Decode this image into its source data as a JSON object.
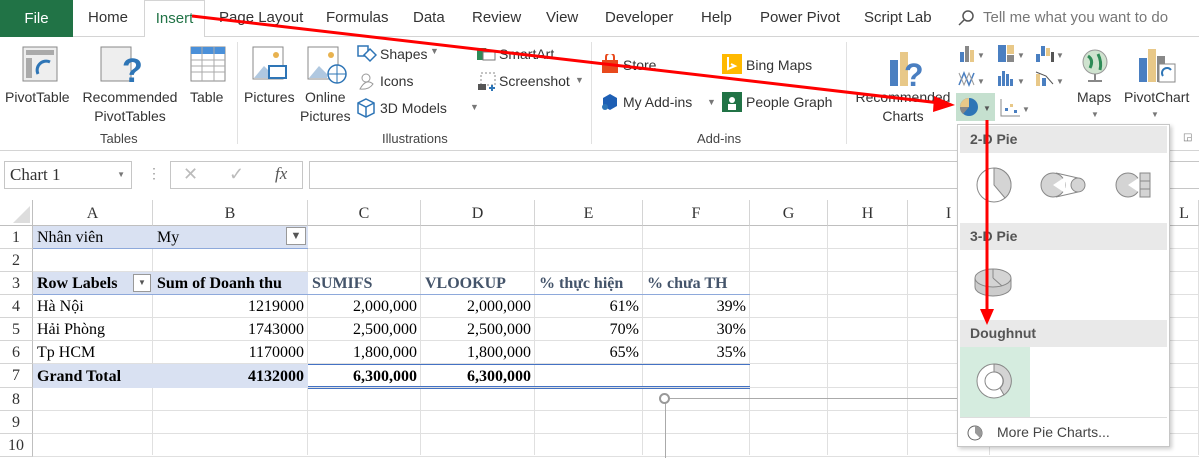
{
  "tabs": {
    "file": "File",
    "items": [
      "Home",
      "Insert",
      "Page Layout",
      "Formulas",
      "Data",
      "Review",
      "View",
      "Developer",
      "Help",
      "Power Pivot",
      "Script Lab"
    ],
    "active": "Insert",
    "tell_me": "Tell me what you want to do"
  },
  "ribbon": {
    "tables": {
      "label": "Tables",
      "pivottable": "PivotTable",
      "recommended": "Recommended",
      "pivottables": "PivotTables",
      "table": "Table"
    },
    "illustrations": {
      "label": "Illustrations",
      "pictures": "Pictures",
      "online1": "Online",
      "online2": "Pictures",
      "shapes": "Shapes",
      "icons": "Icons",
      "models": "3D Models",
      "smartart": "SmartArt",
      "screenshot": "Screenshot"
    },
    "addins": {
      "label": "Add-ins",
      "store": "Store",
      "bing": "Bing Maps",
      "myaddins": "My Add-ins",
      "people": "People Graph"
    },
    "charts": {
      "rec1": "Recommended",
      "rec2": "Charts",
      "maps": "Maps",
      "pivotchart": "PivotChart"
    }
  },
  "formula_bar": {
    "name_box": "Chart 1",
    "fx": "fx",
    "value": ""
  },
  "sheet": {
    "columns": [
      "A",
      "B",
      "C",
      "D",
      "E",
      "F",
      "G",
      "H",
      "I",
      "L"
    ],
    "rows": [
      "1",
      "2",
      "3",
      "4",
      "5",
      "6",
      "7",
      "8",
      "9",
      "10"
    ],
    "r1": {
      "a": "Nhân viên",
      "b": "My"
    },
    "headers": [
      "Row Labels",
      "Sum of Doanh thu",
      "SUMIFS",
      "VLOOKUP",
      "% thực hiện",
      "% chưa TH"
    ],
    "data": [
      [
        "Hà Nội",
        "1219000",
        "2,000,000",
        "2,000,000",
        "61%",
        "39%"
      ],
      [
        "Hải Phòng",
        "1743000",
        "2,500,000",
        "2,500,000",
        "70%",
        "30%"
      ],
      [
        "Tp HCM",
        "1170000",
        "1,800,000",
        "1,800,000",
        "65%",
        "35%"
      ]
    ],
    "total": [
      "Grand Total",
      "4132000",
      "6,300,000",
      "6,300,000"
    ]
  },
  "pie_menu": {
    "sections": [
      "2-D Pie",
      "3-D Pie",
      "Doughnut"
    ],
    "more": "More Pie Charts..."
  },
  "colors": {
    "excel_green": "#217346",
    "pivot_fill": "#d9e1f2",
    "annotation_red": "#ff0000",
    "hover": "#d5ecdf"
  }
}
